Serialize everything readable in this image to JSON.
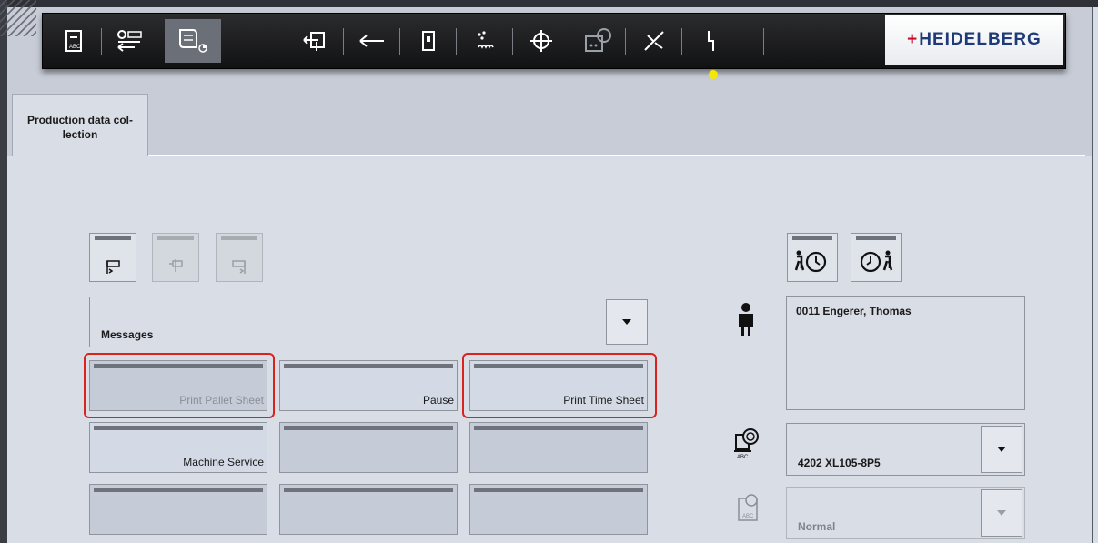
{
  "brand": {
    "logo_text": "HEIDELBERG",
    "accent": "#1e3a78",
    "logo_plus_color": "#c8102e"
  },
  "toolbar": {
    "icons": [
      "abc-job-icon",
      "data-transfer-icon",
      "production-log-icon",
      "feeder-icon",
      "sheet-travel-icon",
      "delivery-icon",
      "dampening-icon",
      "register-icon",
      "color-measurement-icon",
      "wash-icon",
      "power-icon"
    ],
    "status_dot_color": "#f5e800"
  },
  "tab": {
    "label_line1": "Production data col-",
    "label_line2": "lection"
  },
  "messages": {
    "dropdown_label": "Messages",
    "buttons": [
      {
        "label": "Print Pallet Sheet",
        "state": "disabled",
        "highlighted": true
      },
      {
        "label": "Pause",
        "state": "enabled",
        "highlighted": false
      },
      {
        "label": "Print Time Sheet",
        "state": "enabled",
        "highlighted": true
      },
      {
        "label": "Machine Service",
        "state": "enabled",
        "highlighted": false
      },
      {
        "label": "",
        "state": "empty",
        "highlighted": false
      },
      {
        "label": "",
        "state": "empty",
        "highlighted": false
      },
      {
        "label": "",
        "state": "empty",
        "highlighted": false
      },
      {
        "label": "",
        "state": "empty",
        "highlighted": false
      },
      {
        "label": "",
        "state": "empty",
        "highlighted": false
      }
    ]
  },
  "operator": {
    "name": "0011 Engerer, Thomas"
  },
  "machine": {
    "value": "4202 XL105-8P5"
  },
  "mode": {
    "value": "Normal"
  },
  "highlight_color": "#d8231f"
}
